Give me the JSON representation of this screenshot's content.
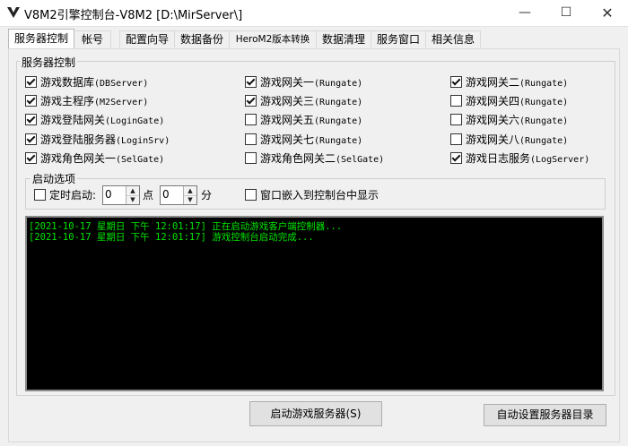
{
  "window": {
    "title": "V8M2引擎控制台-V8M2 [D:\\MirServer\\]",
    "minimize": "—",
    "maximize": "☐",
    "close": "✕"
  },
  "tabs": [
    "服务器控制",
    "帐号",
    "配置向导",
    "数据备份",
    "HeroM2版本转换",
    "数据清理",
    "服务窗口",
    "相关信息"
  ],
  "server_group": {
    "label": "服务器控制",
    "checkboxes": [
      {
        "label": "游戏数据库",
        "code": "(DBServer)",
        "checked": true
      },
      {
        "label": "游戏主程序",
        "code": "(M2Server)",
        "checked": true
      },
      {
        "label": "游戏登陆网关",
        "code": "(LoginGate)",
        "checked": true
      },
      {
        "label": "游戏登陆服务器",
        "code": "(LoginSrv)",
        "checked": true
      },
      {
        "label": "游戏角色网关一",
        "code": "(SelGate)",
        "checked": true
      },
      {
        "label": "游戏网关一",
        "code": "(Rungate)",
        "checked": true
      },
      {
        "label": "游戏网关三",
        "code": "(Rungate)",
        "checked": true
      },
      {
        "label": "游戏网关五",
        "code": "(Rungate)",
        "checked": false
      },
      {
        "label": "游戏网关七",
        "code": "(Rungate)",
        "checked": false
      },
      {
        "label": "游戏角色网关二",
        "code": "(SelGate)",
        "checked": false
      },
      {
        "label": "游戏网关二",
        "code": "(Rungate)",
        "checked": true
      },
      {
        "label": "游戏网关四",
        "code": "(Rungate)",
        "checked": false
      },
      {
        "label": "游戏网关六",
        "code": "(Rungate)",
        "checked": false
      },
      {
        "label": "游戏网关八",
        "code": "(Rungate)",
        "checked": false
      },
      {
        "label": "游戏日志服务",
        "code": "(LogServer)",
        "checked": true
      }
    ]
  },
  "startup_group": {
    "label": "启动选项",
    "timed_start_label": "定时启动:",
    "timed_start_checked": false,
    "hour_value": "0",
    "hour_unit": "点",
    "minute_value": "0",
    "minute_unit": "分",
    "embed_label": "窗口嵌入到控制台中显示",
    "embed_checked": false
  },
  "log": [
    "[2021-10-17 星期日 下午 12:01:17] 正在启动游戏客户端控制器...",
    "[2021-10-17 星期日 下午 12:01:17] 游戏控制台启动完成..."
  ],
  "buttons": {
    "start": "启动游戏服务器(S)",
    "auto_dir": "自动设置服务器目录"
  },
  "colors": {
    "console_bg": "#000000",
    "console_text": "#00e600"
  },
  "icons": {
    "app": "v-logo-icon",
    "spin_up": "▲",
    "spin_down": "▼"
  }
}
